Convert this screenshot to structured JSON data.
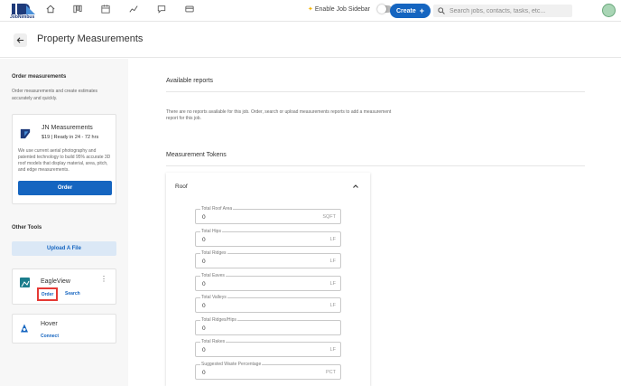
{
  "topbar": {
    "logo_text": "JobNimbus",
    "nav_icons": [
      "home-icon",
      "boards-icon",
      "calendar-icon",
      "activity-icon",
      "messages-icon",
      "payments-icon"
    ],
    "sidebar_toggle_label": "Enable Job Sidebar",
    "sidebar_toggle_on": false,
    "create_label": "Create",
    "search_placeholder": "Search jobs, contacts, tasks, etc...",
    "colors": {
      "accent": "#1565c0",
      "avatar": "#a9d5b5"
    }
  },
  "header": {
    "title": "Property Measurements"
  },
  "left_panel": {
    "order_heading": "Order measurements",
    "order_desc": "Order measurements and create estimates accurately and quickly.",
    "jn_card": {
      "title": "JN Measurements",
      "price": "$19 | Ready in 24 - 72 hrs",
      "desc": "We use current aerial photography and patented technology to build 95% accurate 3D roof models that display material, area, pitch, and edge measurements.",
      "order_label": "Order"
    },
    "other_tools_heading": "Other Tools",
    "upload_label": "Upload A File",
    "eagleview": {
      "title": "EagleView",
      "order_label": "Order",
      "search_label": "Search"
    },
    "hover": {
      "title": "Hover",
      "connect_label": "Connect"
    }
  },
  "main": {
    "reports_heading": "Available reports",
    "reports_desc": "There are no reports available for this job. Order, search or upload measurements reports to add a measurement report for this job.",
    "tokens_heading": "Measurement Tokens",
    "roof": {
      "title": "Roof",
      "fields": [
        {
          "label": "Total Roof Area",
          "value": "0",
          "unit": "SQFT"
        },
        {
          "label": "Total Hips",
          "value": "0",
          "unit": "LF"
        },
        {
          "label": "Total Ridges",
          "value": "0",
          "unit": "LF"
        },
        {
          "label": "Total Eaves",
          "value": "0",
          "unit": "LF"
        },
        {
          "label": "Total Valleys",
          "value": "0",
          "unit": "LF"
        },
        {
          "label": "Total Ridges/Hips",
          "value": "0",
          "unit": ""
        },
        {
          "label": "Total Rakes",
          "value": "0",
          "unit": "LF"
        },
        {
          "label": "Suggested Waste Percentage",
          "value": "0",
          "unit": "PCT"
        }
      ]
    }
  }
}
